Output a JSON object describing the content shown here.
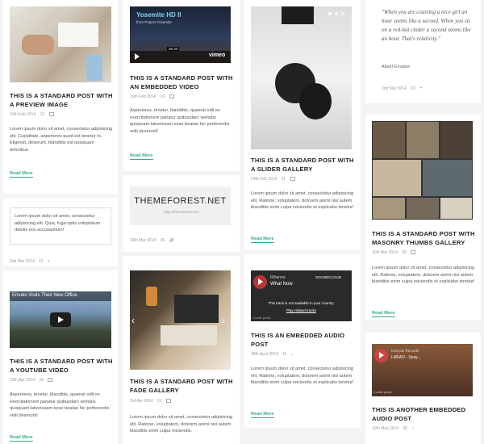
{
  "col1": {
    "post1": {
      "title": "THIS IS A STANDARD POST WITH A PREVIEW IMAGE",
      "date": "10th Feb 2014",
      "comments": "13",
      "excerpt": "Lorem ipsum dolor sit amet, consectetur adipisicing elit. Cupiditate, asperiores quod est tenetur in. Eligendi, deserunt, blanditiis est quisquam doloribus.",
      "more": "Read More"
    },
    "post2": {
      "excerpt": "Lorem ipsum dolor sit amet, consectetur adipisicing elit. Quia, fuga optio voluptatum debitis eos accusantium!",
      "date": "2nd Mar 2014",
      "comments": "11"
    },
    "post3": {
      "video_title": "Envato Visits Their New Office",
      "title": "THIS IS A STANDARD POST WITH A YOUTUBE VIDEO",
      "date": "29th Apr 2014",
      "comments": "16",
      "excerpt": "Asperiores, tenetur, blanditiis, quaerat odit ex exercitationem pariatur quibusdam veritatis quisquam laboriosam esse beatae hic perferendis velit deserunt!",
      "more": "Read More"
    }
  },
  "col2": {
    "post1": {
      "video_title": "Yosemite HD II",
      "video_from": "from Project Yosemite",
      "vimeo": "vimeo",
      "time": "06:33",
      "title": "THIS IS A STANDARD POST WITH AN EMBEDDED VIDEO",
      "date": "16th Feb 2014",
      "comments": "19",
      "excerpt": "Asperiores, tenetur, blanditiis, quaerat odit ex exercitationem pariatur quibusdam veritatis quisquam laboriosam esse beatae hic perferendis velit deserunt!",
      "more": "Read More"
    },
    "post2": {
      "link_title": "THEMEFOREST.NET",
      "link_url": "- http://themeforest.net",
      "date": "16th Mar 2014",
      "comments": "36"
    },
    "post3": {
      "title": "THIS IS A STANDARD POST WITH FADE GALLERY",
      "date": "3rd Apr 2014",
      "comments": "21",
      "excerpt": "Lorem ipsum dolor sit amet, consectetur adipisicing elit. Ratione, voluptatem, dolorem animi nisi autem blanditiis enim culpa reiciendis."
    }
  },
  "col3": {
    "post1": {
      "title": "THIS IS A STANDARD POST WITH A SLIDER GALLERY",
      "date": "24th Feb 2014",
      "comments": "21",
      "excerpt": "Lorem ipsum dolor sit amet, consectetur adipisicing elit. Ratione, voluptatem, dolorem animi nisi autem blanditiis enim culpa reiciendis et explicabo tenetur!",
      "more": "Read More"
    },
    "post2": {
      "audio_artist": "Rihanna",
      "audio_track": "What Now",
      "audio_brand": "SOUNDCLOUD",
      "audio_msg": "This track is not available in your country.",
      "audio_link": "Play related tracks",
      "cookie": "Cookie policy",
      "title": "THIS IS AN EMBEDDED AUDIO POST",
      "date": "28th April 2014",
      "comments": "16",
      "excerpt": "Lorem ipsum dolor sit amet, consectetur adipisicing elit. Ratione, voluptatem, dolorem animi nisi autem blanditiis enim culpa reiciendis et explicabo tenetur!",
      "more": "Read More"
    }
  },
  "col4": {
    "quote": {
      "text": "\"When you are courting a nice girl an hour seems like a second. When you sit on a red-hot cinder a second seems like an hour. That's relativity.\"",
      "author": "Albert Einstein",
      "date": "2nd Mar 2014",
      "comments": "22"
    },
    "post2": {
      "title": "THIS IS A STANDARD POST WITH MASONRY THUMBS GALLERY",
      "date": "11th Mar 2014",
      "comments": "26",
      "excerpt": "Lorem ipsum dolor sit amet, consectetur adipisicing elit. Ratione, voluptatem, dolorem animi nisi autem blanditiis enim culpa reiciendis et explicabo tenetur!",
      "more": "Read More"
    },
    "post3": {
      "audio_artist": "Icecycle Records",
      "audio_track": "LMFAO - Sexy...",
      "cookie": "Cookie policy",
      "title": "THIS IS ANOTHER EMBEDDED AUDIO POST",
      "date": "10th May 2014",
      "comments": "20"
    }
  }
}
